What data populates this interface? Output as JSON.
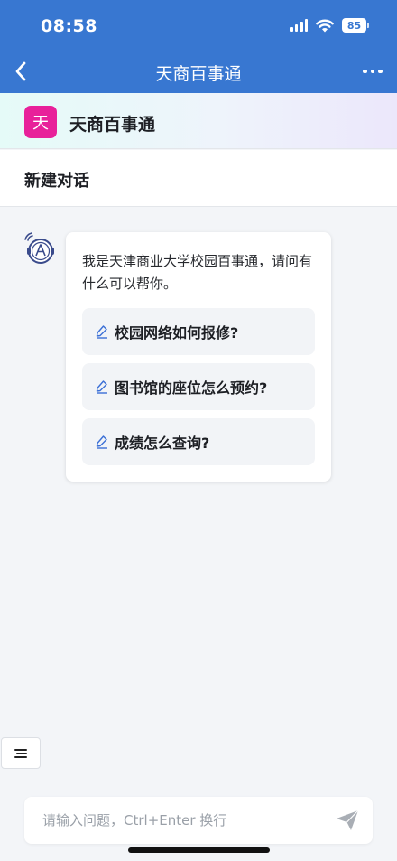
{
  "status_bar": {
    "time": "08:58",
    "battery": "85"
  },
  "navbar": {
    "title": "天商百事通"
  },
  "brand": {
    "logo_char": "天",
    "name": "天商百事通",
    "logo_color": "#e8219a"
  },
  "new_chat": {
    "label": "新建对话"
  },
  "message": {
    "intro": "我是天津商业大学校园百事通，请问有什么可以帮你。",
    "suggestions": [
      {
        "text": "校园网络如何报修?",
        "icon": "pencil-icon"
      },
      {
        "text": "图书馆的座位怎么预约?",
        "icon": "pencil-icon"
      },
      {
        "text": "成绩怎么查询?",
        "icon": "pencil-icon"
      }
    ]
  },
  "input": {
    "placeholder": "请输入问题，Ctrl+Enter 换行",
    "value": ""
  },
  "colors": {
    "header": "#3877d1",
    "accent": "#3b6fd6",
    "background": "#f3f5f8"
  }
}
